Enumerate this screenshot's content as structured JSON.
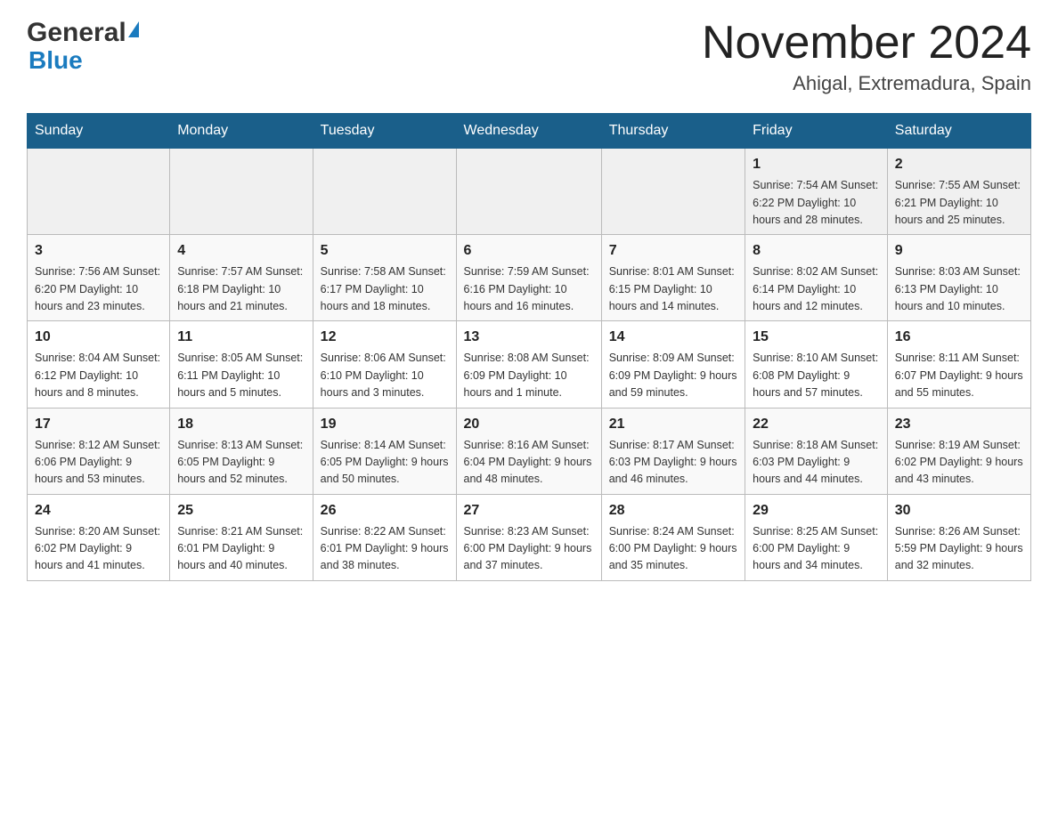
{
  "header": {
    "logo_general": "General",
    "logo_blue": "Blue",
    "month_title": "November 2024",
    "location": "Ahigal, Extremadura, Spain"
  },
  "weekdays": [
    "Sunday",
    "Monday",
    "Tuesday",
    "Wednesday",
    "Thursday",
    "Friday",
    "Saturday"
  ],
  "weeks": [
    [
      {
        "day": "",
        "info": ""
      },
      {
        "day": "",
        "info": ""
      },
      {
        "day": "",
        "info": ""
      },
      {
        "day": "",
        "info": ""
      },
      {
        "day": "",
        "info": ""
      },
      {
        "day": "1",
        "info": "Sunrise: 7:54 AM\nSunset: 6:22 PM\nDaylight: 10 hours\nand 28 minutes."
      },
      {
        "day": "2",
        "info": "Sunrise: 7:55 AM\nSunset: 6:21 PM\nDaylight: 10 hours\nand 25 minutes."
      }
    ],
    [
      {
        "day": "3",
        "info": "Sunrise: 7:56 AM\nSunset: 6:20 PM\nDaylight: 10 hours\nand 23 minutes."
      },
      {
        "day": "4",
        "info": "Sunrise: 7:57 AM\nSunset: 6:18 PM\nDaylight: 10 hours\nand 21 minutes."
      },
      {
        "day": "5",
        "info": "Sunrise: 7:58 AM\nSunset: 6:17 PM\nDaylight: 10 hours\nand 18 minutes."
      },
      {
        "day": "6",
        "info": "Sunrise: 7:59 AM\nSunset: 6:16 PM\nDaylight: 10 hours\nand 16 minutes."
      },
      {
        "day": "7",
        "info": "Sunrise: 8:01 AM\nSunset: 6:15 PM\nDaylight: 10 hours\nand 14 minutes."
      },
      {
        "day": "8",
        "info": "Sunrise: 8:02 AM\nSunset: 6:14 PM\nDaylight: 10 hours\nand 12 minutes."
      },
      {
        "day": "9",
        "info": "Sunrise: 8:03 AM\nSunset: 6:13 PM\nDaylight: 10 hours\nand 10 minutes."
      }
    ],
    [
      {
        "day": "10",
        "info": "Sunrise: 8:04 AM\nSunset: 6:12 PM\nDaylight: 10 hours\nand 8 minutes."
      },
      {
        "day": "11",
        "info": "Sunrise: 8:05 AM\nSunset: 6:11 PM\nDaylight: 10 hours\nand 5 minutes."
      },
      {
        "day": "12",
        "info": "Sunrise: 8:06 AM\nSunset: 6:10 PM\nDaylight: 10 hours\nand 3 minutes."
      },
      {
        "day": "13",
        "info": "Sunrise: 8:08 AM\nSunset: 6:09 PM\nDaylight: 10 hours\nand 1 minute."
      },
      {
        "day": "14",
        "info": "Sunrise: 8:09 AM\nSunset: 6:09 PM\nDaylight: 9 hours\nand 59 minutes."
      },
      {
        "day": "15",
        "info": "Sunrise: 8:10 AM\nSunset: 6:08 PM\nDaylight: 9 hours\nand 57 minutes."
      },
      {
        "day": "16",
        "info": "Sunrise: 8:11 AM\nSunset: 6:07 PM\nDaylight: 9 hours\nand 55 minutes."
      }
    ],
    [
      {
        "day": "17",
        "info": "Sunrise: 8:12 AM\nSunset: 6:06 PM\nDaylight: 9 hours\nand 53 minutes."
      },
      {
        "day": "18",
        "info": "Sunrise: 8:13 AM\nSunset: 6:05 PM\nDaylight: 9 hours\nand 52 minutes."
      },
      {
        "day": "19",
        "info": "Sunrise: 8:14 AM\nSunset: 6:05 PM\nDaylight: 9 hours\nand 50 minutes."
      },
      {
        "day": "20",
        "info": "Sunrise: 8:16 AM\nSunset: 6:04 PM\nDaylight: 9 hours\nand 48 minutes."
      },
      {
        "day": "21",
        "info": "Sunrise: 8:17 AM\nSunset: 6:03 PM\nDaylight: 9 hours\nand 46 minutes."
      },
      {
        "day": "22",
        "info": "Sunrise: 8:18 AM\nSunset: 6:03 PM\nDaylight: 9 hours\nand 44 minutes."
      },
      {
        "day": "23",
        "info": "Sunrise: 8:19 AM\nSunset: 6:02 PM\nDaylight: 9 hours\nand 43 minutes."
      }
    ],
    [
      {
        "day": "24",
        "info": "Sunrise: 8:20 AM\nSunset: 6:02 PM\nDaylight: 9 hours\nand 41 minutes."
      },
      {
        "day": "25",
        "info": "Sunrise: 8:21 AM\nSunset: 6:01 PM\nDaylight: 9 hours\nand 40 minutes."
      },
      {
        "day": "26",
        "info": "Sunrise: 8:22 AM\nSunset: 6:01 PM\nDaylight: 9 hours\nand 38 minutes."
      },
      {
        "day": "27",
        "info": "Sunrise: 8:23 AM\nSunset: 6:00 PM\nDaylight: 9 hours\nand 37 minutes."
      },
      {
        "day": "28",
        "info": "Sunrise: 8:24 AM\nSunset: 6:00 PM\nDaylight: 9 hours\nand 35 minutes."
      },
      {
        "day": "29",
        "info": "Sunrise: 8:25 AM\nSunset: 6:00 PM\nDaylight: 9 hours\nand 34 minutes."
      },
      {
        "day": "30",
        "info": "Sunrise: 8:26 AM\nSunset: 5:59 PM\nDaylight: 9 hours\nand 32 minutes."
      }
    ]
  ]
}
